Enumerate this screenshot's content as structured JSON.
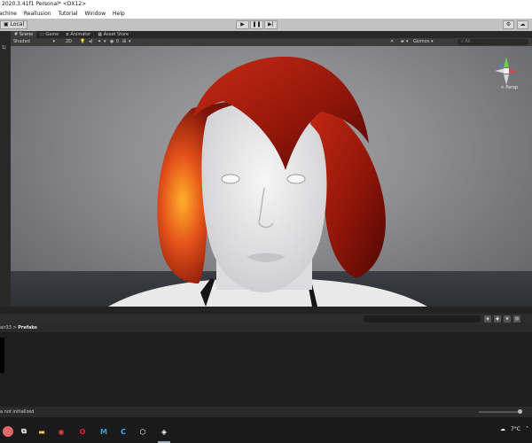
{
  "window": {
    "title": "2020.3.41f1 Personal* <DX12>"
  },
  "menu": [
    "achine",
    "Reallusion",
    "Tutorial",
    "Window",
    "Help"
  ],
  "toolbar": {
    "local_label": "Local",
    "play_icon": "play-icon",
    "pause_icon": "pause-icon",
    "step_icon": "step-icon"
  },
  "scene_tabs": [
    {
      "label": "Scene",
      "active": true,
      "icon": "grid-icon"
    },
    {
      "label": "Game",
      "active": false,
      "icon": "gamepad-icon"
    },
    {
      "label": "Animator",
      "active": false,
      "icon": "animator-icon"
    },
    {
      "label": "Asset Store",
      "active": false,
      "icon": "store-icon"
    }
  ],
  "scene_toolbar": {
    "shading_mode": "Shaded",
    "mode_2d": "2D",
    "gizmos_label": "Gizmos",
    "search_placeholder": "All"
  },
  "gutter": {
    "mark": "1|"
  },
  "viewport": {
    "projection_label": "< Persp"
  },
  "project": {
    "breadcrumb_parent": "air33",
    "breadcrumb_separator": ">",
    "breadcrumb_current": "Prefabs"
  },
  "status": {
    "message": "a not initialized"
  },
  "taskbar": {
    "temperature": "7°C",
    "apps": [
      {
        "name": "task-view-icon",
        "glyph": "⧉",
        "color": "#ffffff"
      },
      {
        "name": "file-explorer-icon",
        "glyph": "▬",
        "color": "#f2c14e"
      },
      {
        "name": "chrome-icon",
        "glyph": "◉",
        "color": "#e3463c"
      },
      {
        "name": "opera-icon",
        "glyph": "O",
        "color": "#e0202a"
      },
      {
        "name": "app-m-icon",
        "glyph": "M",
        "color": "#3aa0d8"
      },
      {
        "name": "app-c-icon",
        "glyph": "C",
        "color": "#4ab0f0"
      },
      {
        "name": "unity-hub-icon",
        "glyph": "⬡",
        "color": "#ffffff"
      },
      {
        "name": "unity-editor-icon",
        "glyph": "◈",
        "color": "#ffffff"
      }
    ]
  },
  "colors": {
    "hair": "#b3200f",
    "hair_highlight": "#ff8a1a",
    "skin": "#ececec"
  }
}
